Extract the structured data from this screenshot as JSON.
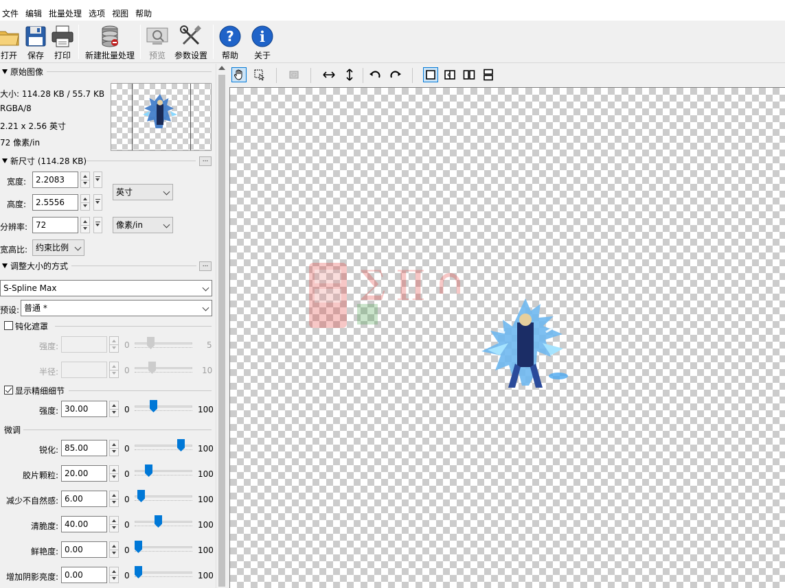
{
  "menu": [
    "文件",
    "编辑",
    "批量处理",
    "选项",
    "视图",
    "帮助"
  ],
  "toolbar": {
    "open": "打开",
    "save": "保存",
    "print": "打印",
    "new_batch": "新建批量处理",
    "preview": "预览",
    "settings": "参数设置",
    "help": "帮助",
    "about": "关于"
  },
  "original": {
    "header": "原始图像",
    "size": "大小: 114.28 KB / 55.7 KB",
    "mode": "RGBA/8",
    "dims": "2.21 x 2.56 英寸",
    "res": "72 像素/in"
  },
  "new_size": {
    "header": "新尺寸 (114.28 KB)",
    "width_label": "宽度:",
    "width_value": "2.2083",
    "height_label": "高度:",
    "height_value": "2.5556",
    "res_label": "分辨率:",
    "res_value": "72",
    "unit": "英寸",
    "res_unit": "像素/in",
    "aspect_label": "宽高比:",
    "aspect_value": "约束比例",
    "more": "..."
  },
  "method": {
    "header": "调整大小的方式",
    "algorithm": "S-Spline Max",
    "preset_label": "预设:",
    "preset_value": "普通 *",
    "more": "..."
  },
  "unsharp": {
    "label": "钝化遮罩",
    "checked": false,
    "strength_label": "强度:",
    "strength_min": "0",
    "strength_max": "5",
    "strength_level": 0.25,
    "radius_label": "半径:",
    "radius_min": "0",
    "radius_max": "10",
    "radius_level": 0.28
  },
  "fine_detail": {
    "label": "显示精细细节",
    "checked": true,
    "strength_label": "强度:",
    "strength_value": "30.00",
    "min": "0",
    "max": "100",
    "level": 0.3
  },
  "finetune": {
    "header": "微调",
    "rows": [
      {
        "label": "锐化:",
        "value": "85.00",
        "min": "0",
        "max": "100",
        "level": 0.85
      },
      {
        "label": "胶片颗粒:",
        "value": "20.00",
        "min": "0",
        "max": "100",
        "level": 0.2
      },
      {
        "label": "减少不自然感:",
        "value": "6.00",
        "min": "0",
        "max": "100",
        "level": 0.06
      },
      {
        "label": "清脆度:",
        "value": "40.00",
        "min": "0",
        "max": "100",
        "level": 0.4
      },
      {
        "label": "鲜艳度:",
        "value": "0.00",
        "min": "0",
        "max": "100",
        "level": 0.0
      },
      {
        "label": "增加阴影亮度:",
        "value": "0.00",
        "min": "0",
        "max": "100",
        "level": 0.0
      }
    ]
  },
  "colors": {
    "accent": "#0078d7",
    "canvas_check": "#cccccc"
  }
}
